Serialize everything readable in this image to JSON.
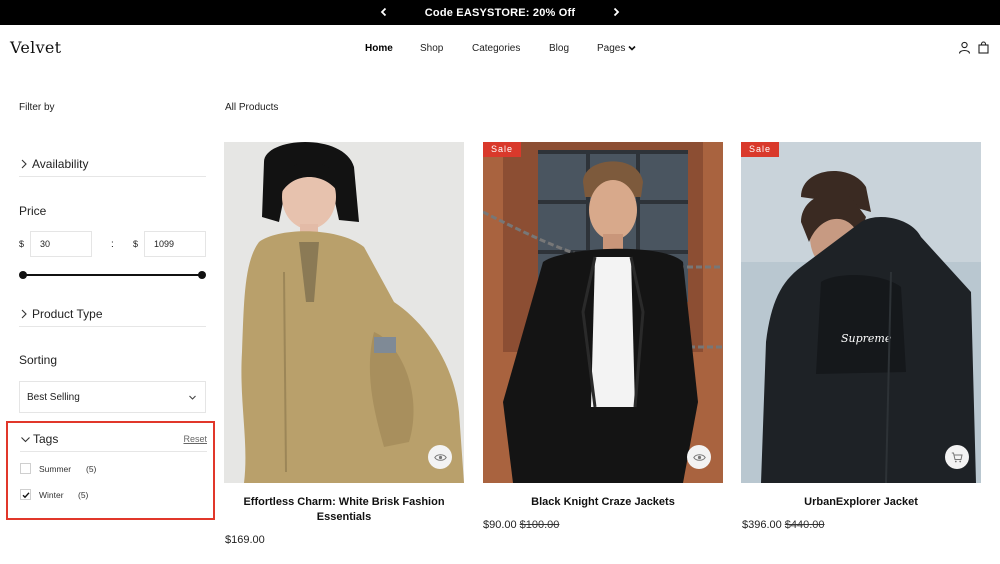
{
  "announcement": {
    "text": "Code EASYSTORE: 20% Off",
    "prev_icon": "chevron-left-icon",
    "next_icon": "chevron-right-icon"
  },
  "header": {
    "logo": "Velvet",
    "nav": [
      {
        "label": "Home",
        "active": true
      },
      {
        "label": "Shop",
        "active": false
      },
      {
        "label": "Categories",
        "active": false
      },
      {
        "label": "Blog",
        "active": false
      },
      {
        "label": "Pages",
        "active": false,
        "has_dropdown": true
      }
    ],
    "icons": [
      "user-icon",
      "bag-icon"
    ]
  },
  "sidebar": {
    "filter_by": "Filter by",
    "availability": "Availability",
    "price": {
      "title": "Price",
      "currency": "$",
      "min": "30",
      "max": "1099",
      "separator": ":"
    },
    "product_type": "Product Type",
    "sorting": {
      "title": "Sorting",
      "selected": "Best Selling"
    },
    "tags": {
      "title": "Tags",
      "reset": "Reset",
      "items": [
        {
          "label": "Summer",
          "count": "(5)",
          "checked": false
        },
        {
          "label": "Winter",
          "count": "(5)",
          "checked": true
        }
      ]
    }
  },
  "main": {
    "heading": "All Products",
    "products": [
      {
        "name": "Effortless Charm: White Brisk Fashion Essentials",
        "price": "$169.00",
        "old_price": "",
        "badge": "",
        "action_icon": "eye-icon"
      },
      {
        "name": "Black Knight Craze Jackets",
        "price": "$90.00",
        "old_price": "$100.00",
        "badge": "Sale",
        "action_icon": "eye-icon"
      },
      {
        "name": "UrbanExplorer Jacket",
        "price": "$396.00",
        "old_price": "$440.00",
        "badge": "Sale",
        "action_icon": "cart-icon"
      }
    ]
  },
  "colors": {
    "accent": "#d9392b",
    "highlight_border": "#e1372a",
    "bar": "#000000"
  }
}
